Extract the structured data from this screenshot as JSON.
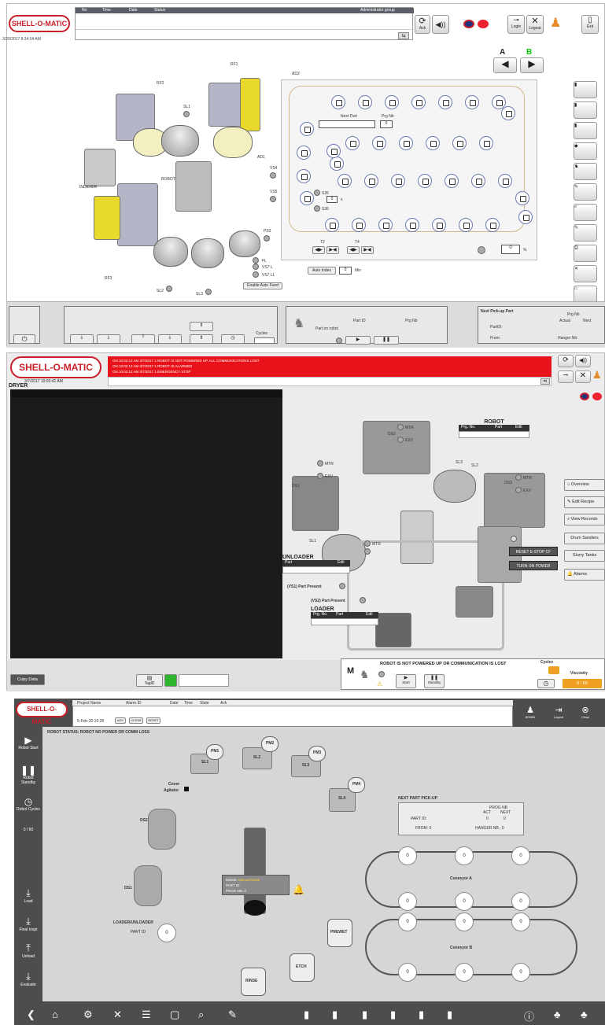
{
  "brand": {
    "name": "SHELL-O-MATIC",
    "red": "#c8202a"
  },
  "panel1": {
    "alarm_headers": [
      "No",
      "Time",
      "Date",
      "Status"
    ],
    "access_group": "Administrator group",
    "timestamp": "3/20/2017 8:34:54 AM",
    "ack_label": "Ack",
    "login_label": "Login",
    "logout_label": "Logout",
    "exit_label": "Exit",
    "nav": {
      "a": "A",
      "b": "B"
    },
    "labels": {
      "rf1": "RF1",
      "rf2": "RF2",
      "rf3": "RF3",
      "sl1": "SL1",
      "sl2": "SL2",
      "sl3": "SL3",
      "ps3": "PS3",
      "indexer": "INDEXER",
      "robot": "ROBOT",
      "ad2": "AD2",
      "ad1": "AD1",
      "vs4": "VS4",
      "vs5": "VS5",
      "s35": "S35",
      "s36": "S36",
      "t2": "T2",
      "t4": "T4",
      "fl": "FL",
      "vs7l": "VS7 L",
      "vs7ll": "VS7 LL"
    },
    "next_part_label": "Next Part",
    "prg_nb_label": "Prg Nb",
    "prg_nb_value": "0",
    "timer_value": "0",
    "timer_unit": "s",
    "percent_value": "0",
    "percent_unit": "%",
    "enable_auto_feed": "Enable Auto Feed",
    "auto_index_label": "Auto Index",
    "auto_index_value": "0",
    "auto_index_unit": "Min",
    "cycles_label": "Cycles",
    "part_on_robot_label": "Part on robot",
    "part_id_label": "Part ID",
    "robot_prg_nb_label": "Prg Nb",
    "next_pickup": {
      "title": "Next Pick-up Part",
      "prg_nb": "Prg Nb",
      "actual": "Actual",
      "next": "Next",
      "part_id": "PartID:",
      "from": "From:",
      "hanger_nb": "Hanger Nb:"
    }
  },
  "panel2": {
    "timestamp": "3/7/2017 10:02:41 AM",
    "section": "DRYER",
    "alarm_rows": [
      "ON  10:02:12 AM  3/7/2017  1  ROBOT IS NOT POWERED UP, ALL COMMUNICATIONS LOST",
      "ON  10:02:12 AM  3/7/2017  1  ROBOT IS ALARMED",
      "ON  10:02:12 AM  3/7/2017  1  EMERGENCY STOP"
    ],
    "table_headers": [
      "TagID",
      "Part",
      "Cout",
      "TagID",
      "Part",
      "Cout",
      "TagID",
      "Part",
      "Cout"
    ],
    "cell_value": "0 / 0",
    "row_count": 30,
    "labels": {
      "ds1": "DS1",
      "ds2": "DS2",
      "ds3": "DS3",
      "mtr": "MTR",
      "exv": "EXV",
      "sl1": "SL1",
      "sl2": "SL2",
      "sl3": "SL3"
    },
    "robot_title": "ROBOT",
    "robot_cols": [
      "Prg. No.",
      "Part",
      "Edit"
    ],
    "unloader_title": "UNLOADER",
    "unloader_cols": [
      "Part",
      "Edit"
    ],
    "vs1": "(VS1) Part Present",
    "vs2": "(VS2) Part Present",
    "loader_title": "LOADER",
    "loader_cols": [
      "Prg. No.",
      "Part",
      "Edit"
    ],
    "reset_estop": "RESET E-STOP CF",
    "turn_on_power": "TURN ON POWER",
    "menu": [
      "Overview",
      "Edit Recipe",
      "View Records",
      "Drum Sanders",
      "Slurry Tanks",
      "Alarms"
    ],
    "copy_data": "Copy Data",
    "tagid_btn": "TagID",
    "status_msg": "ROBOT IS NOT POWERED UP OR COMMUNICATION IS LOST",
    "mode_letter": "M",
    "start_label": "Start",
    "standby_label": "Standby",
    "cycles_label": "Cycles",
    "viscosity_label": "Viscosity",
    "viscosity_value": "0 / 60"
  },
  "panel3": {
    "alarm_headers": [
      "Project Name",
      "Alarm ID",
      "Date",
      "Time",
      "State",
      "Ack"
    ],
    "date": "6-Feb-20 10:28",
    "small_btns": [
      "ACK",
      "CLEAR",
      "RESET"
    ],
    "user_label": "ADMIN",
    "logout_label": "Logout",
    "close_label": "Close",
    "robot_status": "ROBOT STATUS:  ROBOT NO POWER OR COMM LOSS",
    "left_menu": [
      "Robot Start",
      "Robot Standby",
      "Robot Cycles",
      "0 / 60",
      "Load",
      "Final Inspt",
      "Unload",
      "Evaluate"
    ],
    "labels": {
      "sl1": "SL1",
      "sl2": "SL2",
      "sl3": "SL3",
      "sl4": "SL4",
      "pm1": "PM1",
      "pm2": "PM2",
      "pm3": "PM3",
      "pm4": "PM4",
      "ds1": "DS1",
      "ds2": "DS2",
      "cover": "Cover",
      "agitator": "Agitator",
      "prewet": "PREWET",
      "etch": "ETCH",
      "rinse": "RINSE"
    },
    "robot_box": {
      "mode": "MODE:",
      "mode_value": "Manual Mode",
      "part_id": "PART ID:",
      "prog_nb": "PROG NB:",
      "prog_value": "0"
    },
    "next_pickup": {
      "title": "NEXT PART PICK-UP",
      "prog_nb": "PROG NB",
      "act": "ACT",
      "next": "NEXT",
      "part_id": "PART ID:",
      "act_val": "0",
      "next_val": "0",
      "from": "FROM: 0",
      "hanger": "HANGER NB.: 0"
    },
    "loader_title": "LOADER/UNLOADER",
    "loader_part_id": "PART ID",
    "loader_value": "0",
    "conveyor_a": "Conveyor A",
    "conveyor_b": "Conveyor B",
    "node_value": "0"
  }
}
